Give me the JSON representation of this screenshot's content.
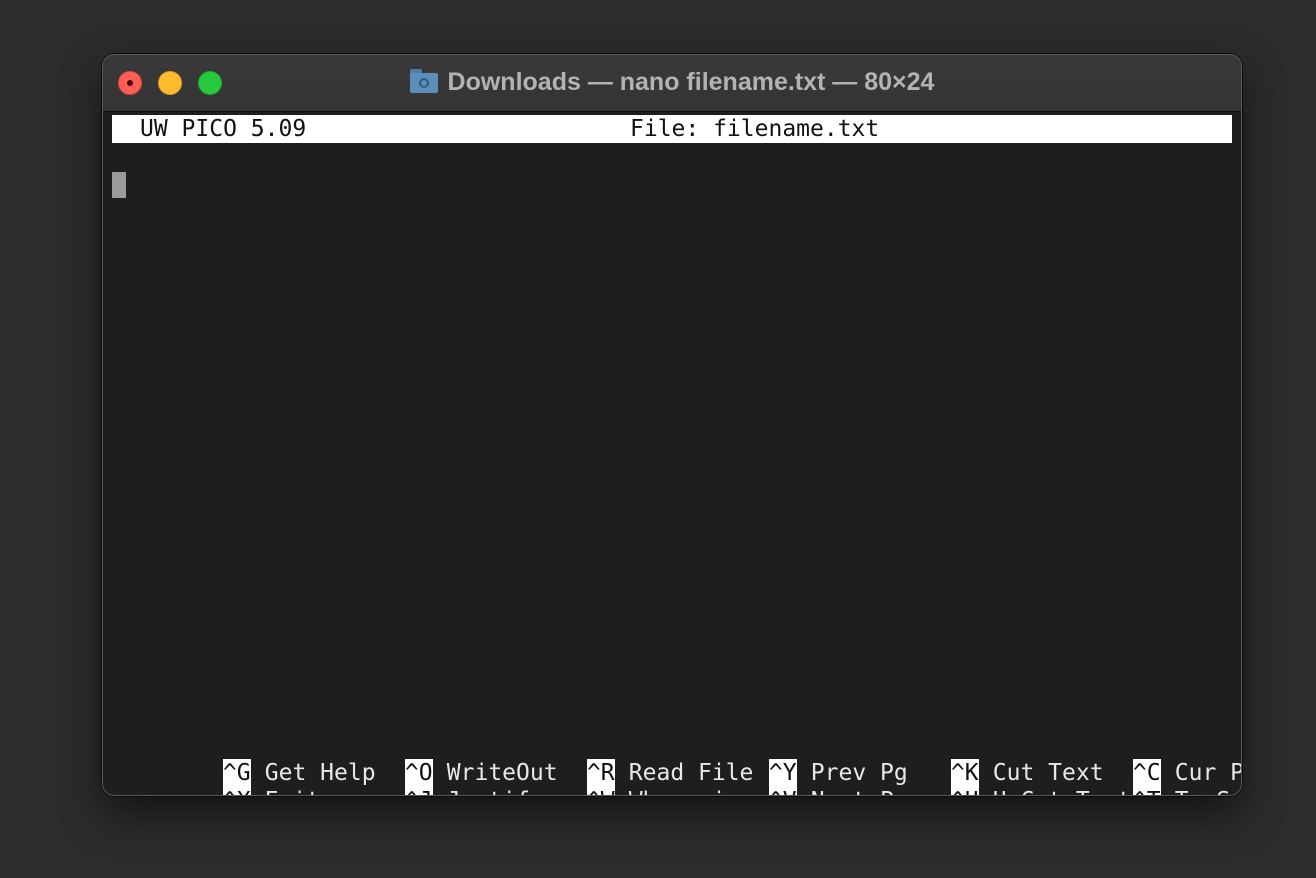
{
  "window": {
    "title": "Downloads — nano filename.txt — 80×24"
  },
  "editor": {
    "version": "UW PICO 5.09",
    "file": "File: filename.txt"
  },
  "shortcuts": {
    "row1": [
      {
        "key": "^G",
        "label": "Get Help"
      },
      {
        "key": "^O",
        "label": "WriteOut"
      },
      {
        "key": "^R",
        "label": "Read File"
      },
      {
        "key": "^Y",
        "label": "Prev Pg"
      },
      {
        "key": "^K",
        "label": "Cut Text"
      },
      {
        "key": "^C",
        "label": "Cur Pos"
      }
    ],
    "row2": [
      {
        "key": "^X",
        "label": "Exit"
      },
      {
        "key": "^J",
        "label": "Justify"
      },
      {
        "key": "^W",
        "label": "Where is"
      },
      {
        "key": "^V",
        "label": "Next Pg"
      },
      {
        "key": "^U",
        "label": "UnCut Text"
      },
      {
        "key": "^T",
        "label": "To Spell"
      }
    ]
  },
  "colors": {
    "close": "#ff5f57",
    "minimize": "#febc2e",
    "zoom": "#28c840",
    "terminal_bg": "#1e1e1e"
  },
  "icons": {
    "title_icon": "folder-icon"
  }
}
